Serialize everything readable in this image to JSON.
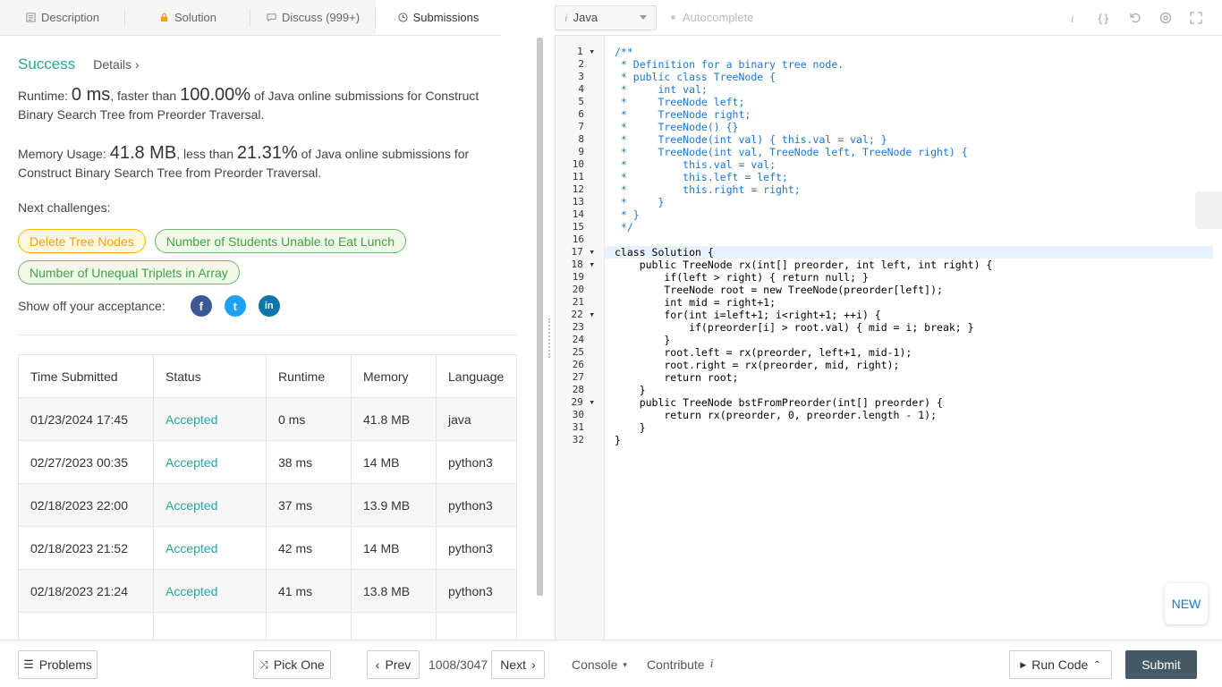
{
  "tabs": [
    {
      "label": "Description",
      "icon": "document-icon"
    },
    {
      "label": "Solution",
      "icon": "lock-icon"
    },
    {
      "label": "Discuss (999+)",
      "icon": "chat-icon"
    },
    {
      "label": "Submissions",
      "icon": "clock-icon"
    }
  ],
  "result": {
    "status": "Success",
    "details": "Details",
    "details_arrow": "›",
    "runtime_label": "Runtime:",
    "runtime_value": "0 ms",
    "runtime_mid": ", faster than",
    "runtime_pct": "100.00%",
    "runtime_tail": "of Java online submissions for Construct Binary Search Tree from Preorder Traversal.",
    "memory_label": "Memory Usage:",
    "memory_value": "41.8 MB",
    "memory_mid": ", less than",
    "memory_pct": "21.31%",
    "memory_tail": "of Java online submissions for Construct Binary Search Tree from Preorder Traversal."
  },
  "next": {
    "title": "Next challenges:",
    "chips": [
      "Delete Tree Nodes",
      "Number of Students Unable to Eat Lunch",
      "Number of Unequal Triplets in Array"
    ]
  },
  "share": {
    "label": "Show off your acceptance:",
    "facebook": "f",
    "twitter": "t",
    "linkedin": "in"
  },
  "table": {
    "headers": [
      "Time Submitted",
      "Status",
      "Runtime",
      "Memory",
      "Language"
    ],
    "rows": [
      [
        "01/23/2024 17:45",
        "Accepted",
        "0 ms",
        "41.8 MB",
        "java"
      ],
      [
        "02/27/2023 00:35",
        "Accepted",
        "38 ms",
        "14 MB",
        "python3"
      ],
      [
        "02/18/2023 22:00",
        "Accepted",
        "37 ms",
        "13.9 MB",
        "python3"
      ],
      [
        "02/18/2023 21:52",
        "Accepted",
        "42 ms",
        "14 MB",
        "python3"
      ],
      [
        "02/18/2023 21:24",
        "Accepted",
        "41 ms",
        "13.8 MB",
        "python3"
      ]
    ]
  },
  "toolbar": {
    "language": "Java",
    "lang_icon": "i",
    "autocomplete": "Autocomplete"
  },
  "code_lines": [
    "/**",
    " * Definition for a binary tree node.",
    " * public class TreeNode {",
    " *     int val;",
    " *     TreeNode left;",
    " *     TreeNode right;",
    " *     TreeNode() {}",
    " *     TreeNode(int val) { this.val = val; }",
    " *     TreeNode(int val, TreeNode left, TreeNode right) {",
    " *         this.val = val;",
    " *         this.left = left;",
    " *         this.right = right;",
    " *     }",
    " * }",
    " */",
    "",
    "class Solution {",
    "    public TreeNode rx(int[] preorder, int left, int right) {",
    "        if(left > right) { return null; }",
    "        TreeNode root = new TreeNode(preorder[left]);",
    "        int mid = right+1;",
    "        for(int i=left+1; i<right+1; ++i) {",
    "            if(preorder[i] > root.val) { mid = i; break; }",
    "        }",
    "        root.left = rx(preorder, left+1, mid-1);",
    "        root.right = rx(preorder, mid, right);",
    "        return root;",
    "    }",
    "    public TreeNode bstFromPreorder(int[] preorder) {",
    "        return rx(preorder, 0, preorder.length - 1);",
    "    }",
    "}"
  ],
  "line_numbers": [
    "1 ▾",
    "2",
    "3",
    "4",
    "5",
    "6",
    "7",
    "8",
    "9",
    "10",
    "11",
    "12",
    "13",
    "14",
    "15",
    "16",
    "17 ▾",
    "18 ▾",
    "19",
    "20",
    "21",
    "22 ▾",
    "23",
    "24",
    "25",
    "26",
    "27",
    "28",
    "29 ▾",
    "30",
    "31",
    "32"
  ],
  "new_badge": "NEW",
  "bottom": {
    "problems": "Problems",
    "pick_one": "Pick One",
    "prev": "Prev",
    "counter": "1008/3047",
    "next": "Next",
    "console": "Console",
    "contribute": "Contribute",
    "run_code": "Run Code",
    "submit": "Submit"
  }
}
